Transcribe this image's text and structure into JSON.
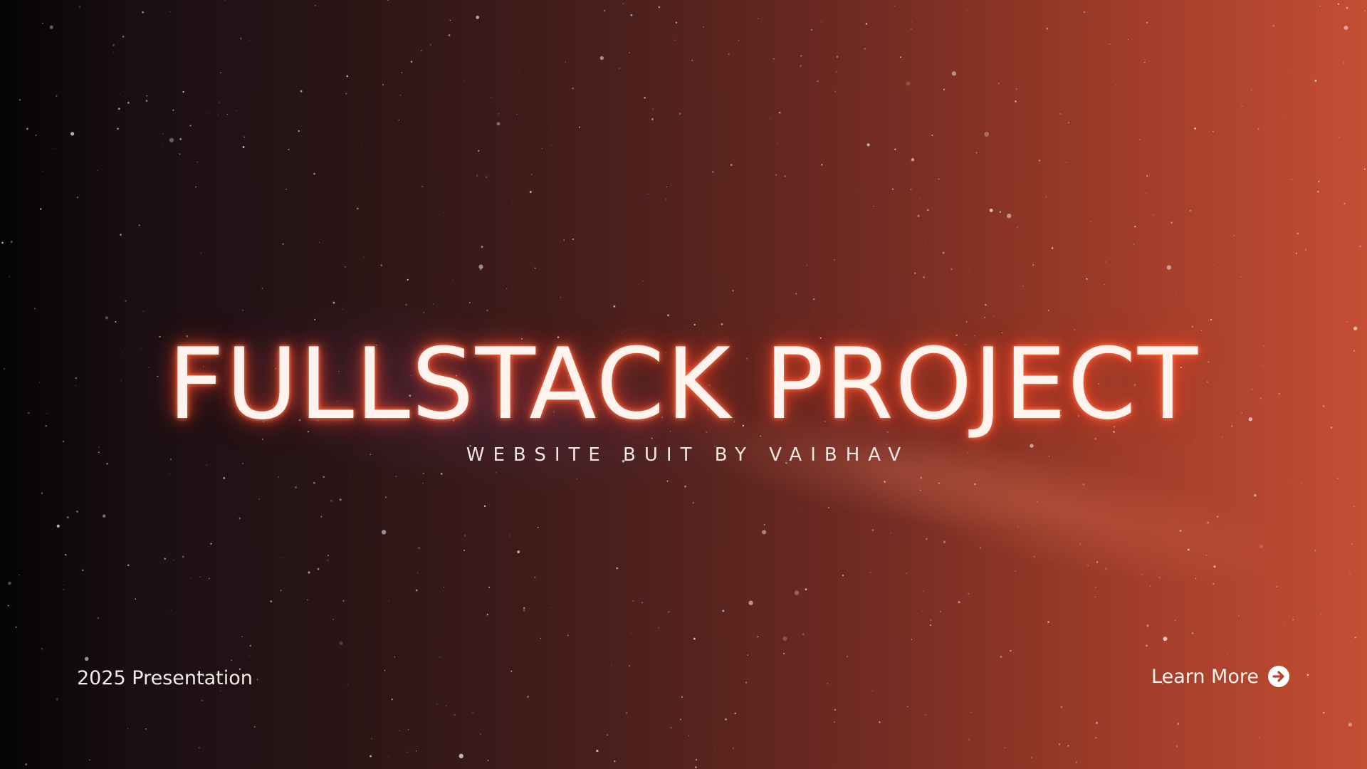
{
  "slide": {
    "title": "FULLSTACK PROJECT",
    "subtitle": "WEBSITE BUIT BY VAIBHAV",
    "footer_left": "2025 Presentation",
    "learn_more_label": "Learn More",
    "learn_more_icon": "arrow-circle-right-icon"
  },
  "colors": {
    "background_left": "#050306",
    "background_right": "#c54e34",
    "title_text": "#fff3ee",
    "title_glow": "#ff5a32"
  }
}
